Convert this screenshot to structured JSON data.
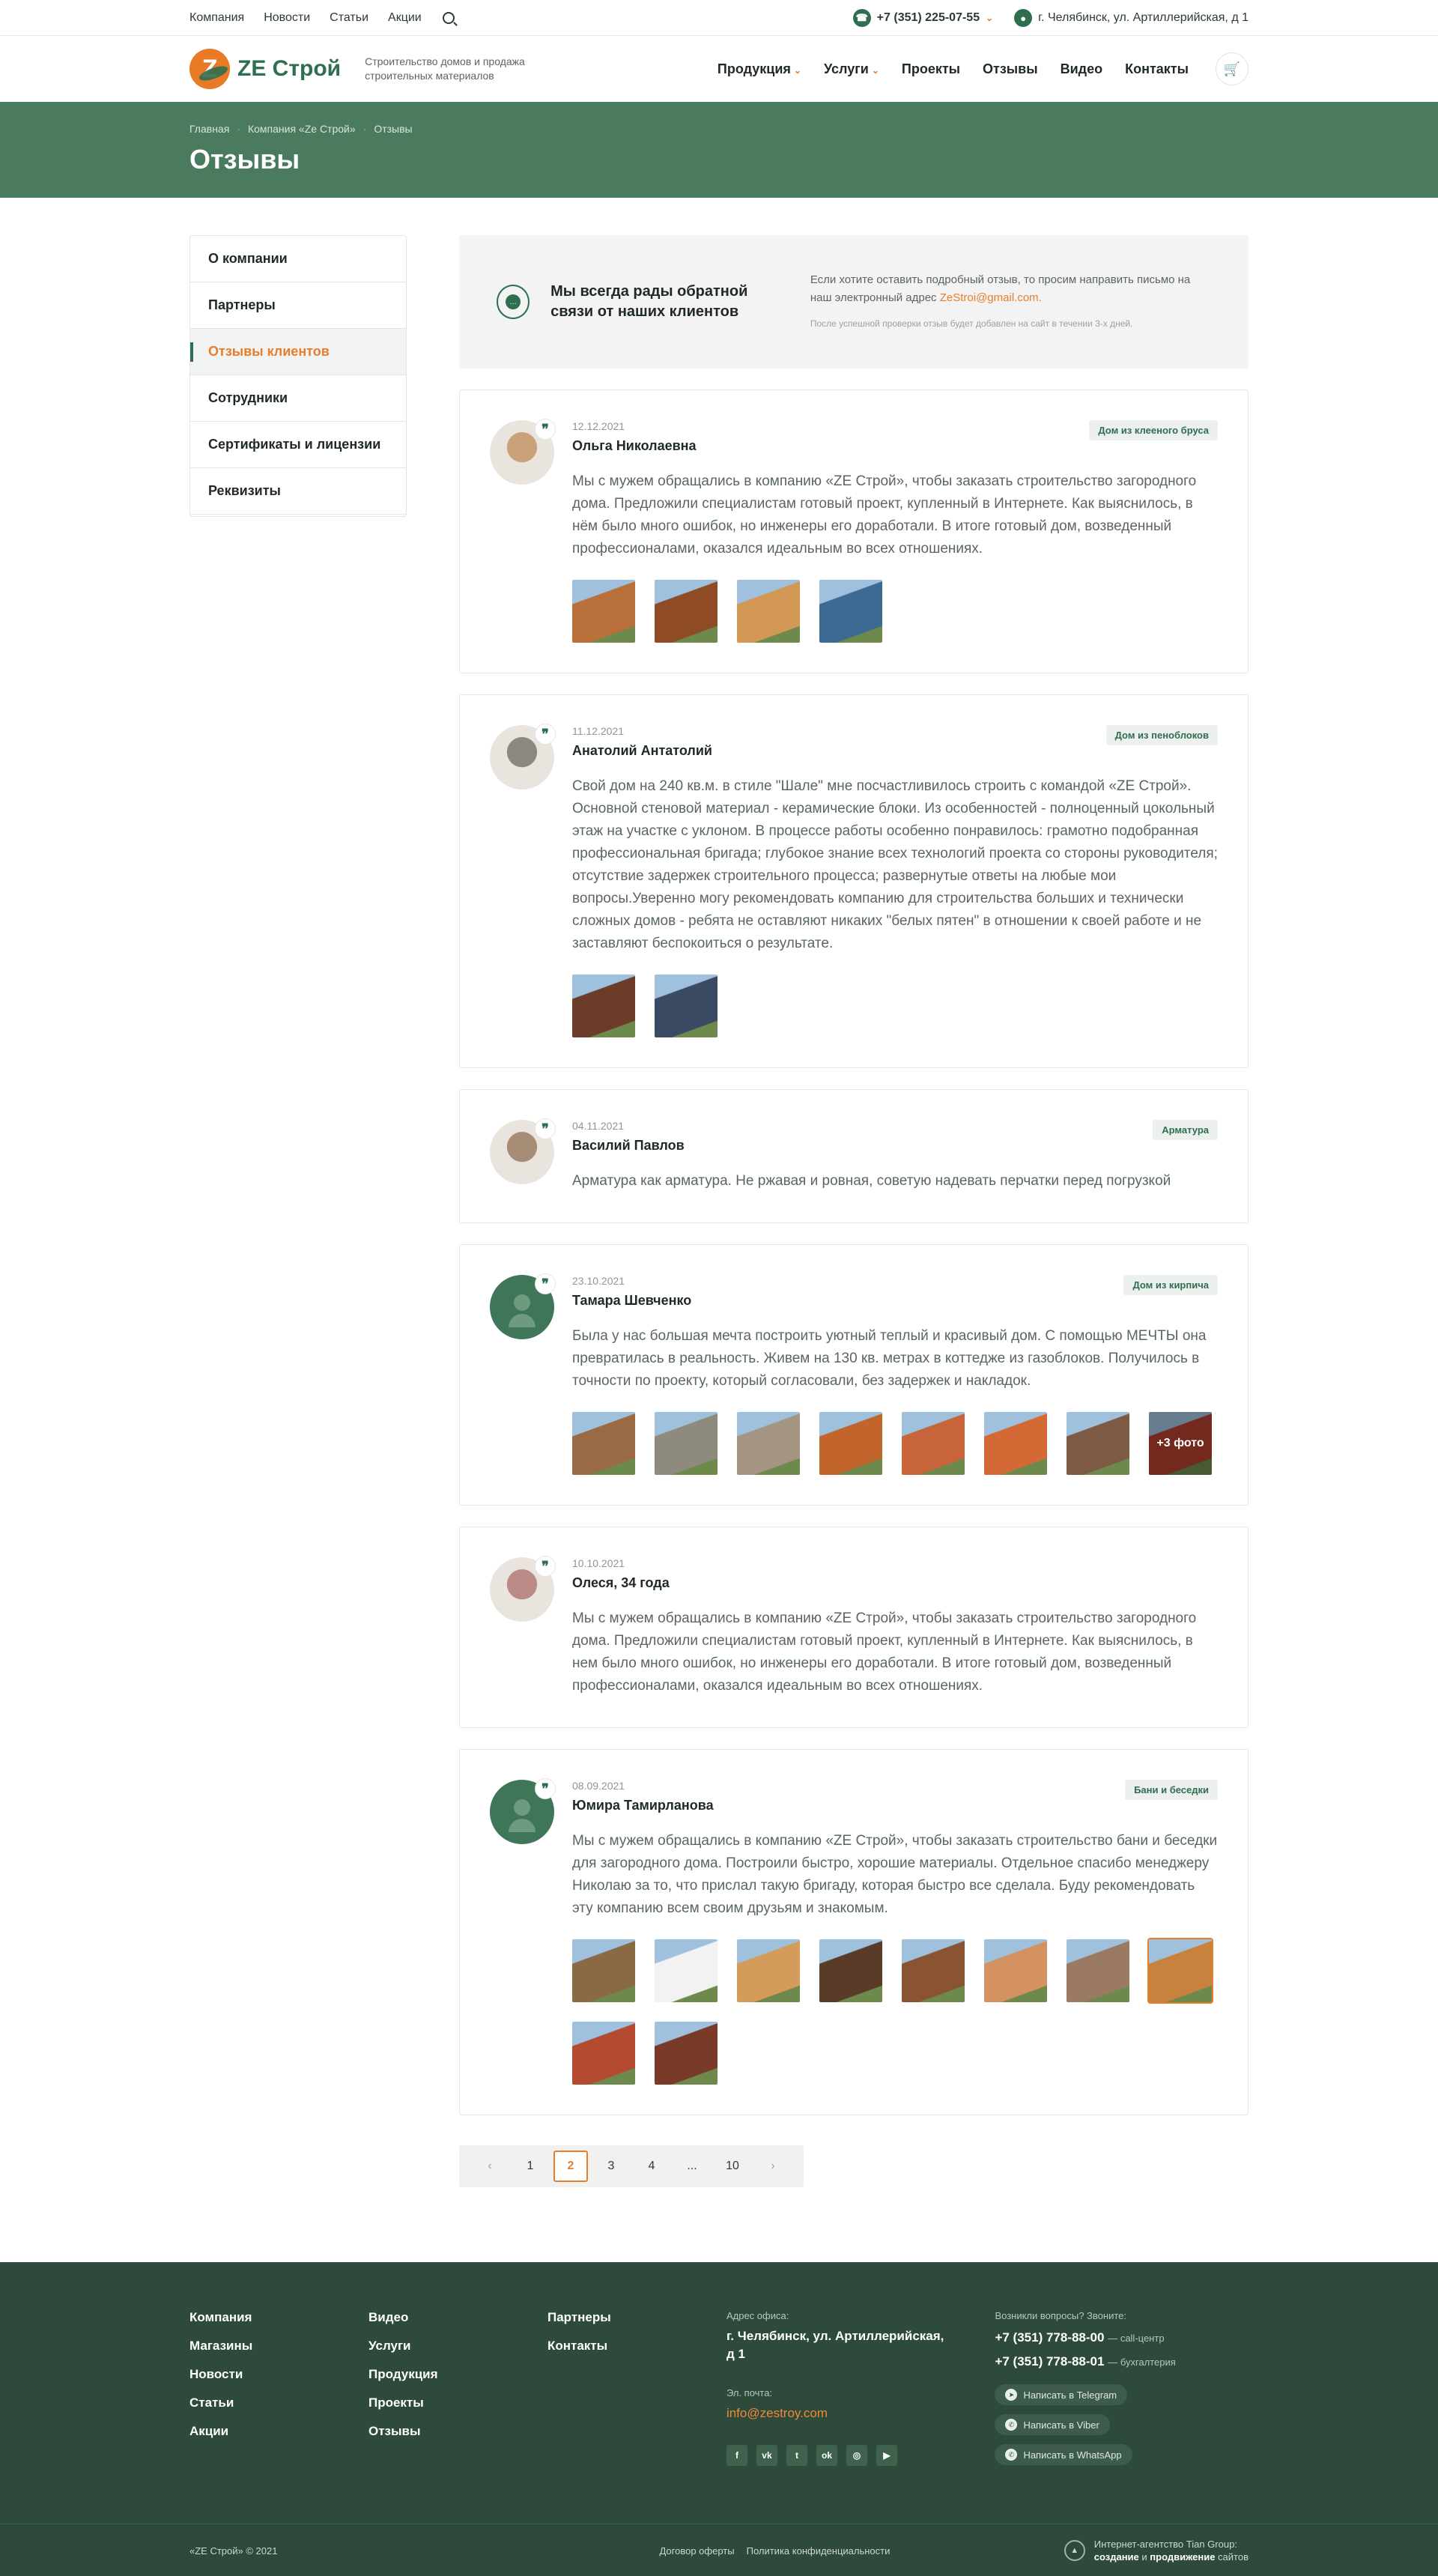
{
  "topbar": {
    "nav": [
      "Компания",
      "Новости",
      "Статьи",
      "Акции"
    ],
    "phone": "+7 (351) 225-07-55",
    "address": "г. Челябинск, ул. Артиллерийская, д 1"
  },
  "header": {
    "logo_text": "ZE Строй",
    "tagline": "Строительство домов и продажа строительных материалов",
    "nav": [
      {
        "label": "Продукция",
        "dropdown": true
      },
      {
        "label": "Услуги",
        "dropdown": true
      },
      {
        "label": "Проекты",
        "dropdown": false
      },
      {
        "label": "Отзывы",
        "dropdown": false
      },
      {
        "label": "Видео",
        "dropdown": false
      },
      {
        "label": "Контакты",
        "dropdown": false
      }
    ]
  },
  "banner": {
    "breadcrumbs": [
      "Главная",
      "Компания «Ze Строй»",
      "Отзывы"
    ],
    "title": "Отзывы"
  },
  "sidebar": {
    "items": [
      "О компании",
      "Партнеры",
      "Отзывы клиентов",
      "Сотрудники",
      "Сертификаты и лицензии",
      "Реквизиты"
    ],
    "active_index": 2
  },
  "feedback": {
    "title": "Мы всегда рады обратной связи от наших клиентов",
    "text": "Если хотите оставить подробный отзыв, то просим направить письмо на наш электронный адрес",
    "email": "ZeStroi@gmail.com.",
    "note": "После успешной проверки отзыв будет добавлен на сайт в течении 3-х дней."
  },
  "reviews": [
    {
      "date": "12.12.2021",
      "name": "Ольга Николаевна",
      "tag": "Дом из клееного бруса",
      "avatar": "photo",
      "face": "#c9a27a",
      "text": "Мы с мужем обращались в компанию «ZE Строй», чтобы заказать строительство загородного дома. Предложили специалистам готовый проект, купленный в Интернете. Как выяснилось, в нём было много ошибок, но инженеры его доработали. В итоге готовый дом, возведенный профессионалами, оказался идеальным во всех отношениях.",
      "photos": [
        "#b9703a",
        "#8e4b25",
        "#d39856",
        "#3d6a93"
      ],
      "more": ""
    },
    {
      "date": "11.12.2021",
      "name": "Анатолий Антатолий",
      "tag": "Дом из пеноблоков",
      "avatar": "photo",
      "face": "#8c8780",
      "text": "Свой дом на 240 кв.м. в стиле \"Шале\" мне посчастливилось строить с командой «ZE Строй». Основной стеновой материал - керамические блоки. Из особенностей - полноценный цокольный этаж на участке с уклоном. В процессе работы особенно понравилось: грамотно подобранная профессиональная бригада; глубокое знание всех технологий проекта со стороны руководителя; отсутствие задержек строительного процесса; развернутые ответы на любые мои вопросы.Уверенно могу рекомендовать компанию для строительства больших и технически сложных домов - ребята не оставляют никаких \"белых пятен\" в отношении к своей работе и не заставляют беспокоиться о результате.",
      "photos": [
        "#6c3b2a",
        "#3b4a63"
      ],
      "more": ""
    },
    {
      "date": "04.11.2021",
      "name": "Василий Павлов",
      "tag": "Арматура",
      "avatar": "photo",
      "face": "#a88d76",
      "text": "Арматура как арматура. Не ржавая и ровная, советую надевать перчатки перед погрузкой",
      "photos": [],
      "more": ""
    },
    {
      "date": "23.10.2021",
      "name": "Тамара Шевченко",
      "tag": "Дом из кирпича",
      "avatar": "green",
      "face": "",
      "text": "Была у нас большая мечта построить уютный теплый и красивый дом. С помощью МЕЧТЫ она превратилась в реальность. Живем на 130 кв. метрах в коттедже из газоблоков. Получилось в точности по проекту, который согласовали, без задержек и накладок.",
      "photos": [
        "#9a6a45",
        "#8e8a7d",
        "#a49583",
        "#c2652c",
        "#c8643a",
        "#d36a35",
        "#7c5a44",
        "#b3402e"
      ],
      "more": "+3 фото"
    },
    {
      "date": "10.10.2021",
      "name": "Олеся, 34 года",
      "tag": "",
      "avatar": "photo",
      "face": "#b98a86",
      "text": "Мы с мужем обращались в компанию «ZE Строй», чтобы заказать строительство загородного дома. Предложили специалистам готовый проект, купленный в Интернете. Как выяснилось, в нем было много ошибок, но инженеры его доработали. В итоге готовый дом, возведенный профессионалами, оказался идеальным во всех отношениях.",
      "photos": [],
      "more": ""
    },
    {
      "date": "08.09.2021",
      "name": "Юмира Тамирланова",
      "tag": "Бани и беседки",
      "avatar": "green",
      "face": "",
      "text": "Мы с мужем обращались в компанию «ZE Строй», чтобы заказать строительство бани и беседки для загородного дома. Построили быстро, хорошие материалы. Отдельное спасибо менеджеру Николаю за то, что прислал такую бригаду, которая быстро все сделала. Буду рекомендовать эту компанию всем своим друзьям и знакомым.",
      "photos": [
        "#8a6a44",
        "#f2f2f2",
        "#d59b5a",
        "#5a3b28",
        "#8a5432",
        "#d49260",
        "#9a7a62",
        "#c9823e",
        "#b44a30",
        "#7a3a2a"
      ],
      "more": ""
    }
  ],
  "pagination": {
    "pages": [
      "1",
      "2",
      "3",
      "4",
      "...",
      "10"
    ],
    "current": "2",
    "prev": "‹",
    "next": "›"
  },
  "footer": {
    "col1": [
      "Компания",
      "Магазины",
      "Новости",
      "Статьи",
      "Акции"
    ],
    "col2": [
      "Видео",
      "Услуги",
      "Продукция",
      "Проекты",
      "Отзывы"
    ],
    "col3": [
      "Партнеры",
      "Контакты"
    ],
    "address_label": "Адрес офиса:",
    "address": "г. Челябинск, ул. Артиллерийская, д 1",
    "email_label": "Эл. почта:",
    "email": "info@zestroy.com",
    "socials": [
      "f",
      "vk",
      "tw",
      "ok",
      "ig",
      "yt"
    ],
    "questions_label": "Возникли вопросы? Звоните:",
    "phone1": "+7 (351) 778-88-00",
    "phone1_note": "— call-центр",
    "phone2": "+7 (351) 778-88-01",
    "phone2_note": "— бухгалтерия",
    "messengers": [
      "Написать в Telegram",
      "Написать в Viber",
      "Написать в WhatsApp"
    ],
    "copyright": "«ZE Строй» © 2021",
    "links": [
      "Договор оферты",
      "Политика конфиденциальности"
    ],
    "agency_line1": "Интернет-агентство Tian Group:",
    "agency_b1": "создание",
    "agency_mid": " и ",
    "agency_b2": "продвижение",
    "agency_end": " сайтов"
  }
}
